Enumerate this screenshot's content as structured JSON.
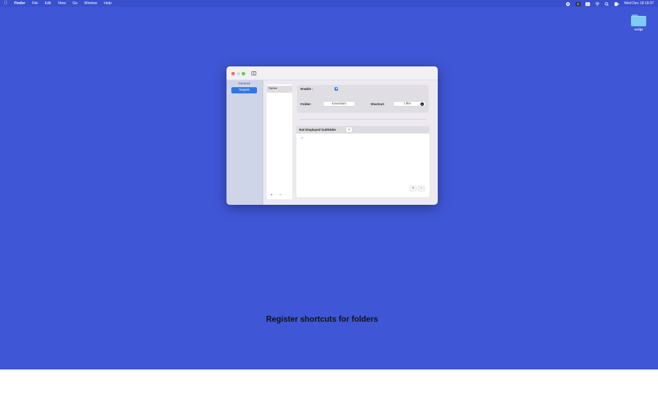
{
  "menubar": {
    "apple": "",
    "items": [
      "Finder",
      "File",
      "Edit",
      "View",
      "Go",
      "Window",
      "Help"
    ],
    "clock": "Wed Dec 18  18:37"
  },
  "desktop": {
    "folder_label": "script",
    "caption": "Register shortcuts for folders",
    "background_color": "#3f56d6"
  },
  "window": {
    "sidebar": {
      "items": [
        {
          "label": "General",
          "selected": false
        },
        {
          "label": "Targets",
          "selected": true
        }
      ]
    },
    "targets_list": {
      "rows": [
        "home"
      ],
      "add_label": "+",
      "remove_label": "−"
    },
    "settings": {
      "enable_label": "Enable :",
      "enable_checked": true,
      "folder_label": "Folder:",
      "folder_value": "/Users/tom",
      "shortcut_label": "Shortcut:",
      "shortcut_value": "⇧⌘H"
    },
    "subfolders": {
      "header": "Not Displayed Subfolder",
      "help_label": "?",
      "items": [
        ".*"
      ],
      "add_label": "+",
      "remove_label": "−"
    }
  }
}
